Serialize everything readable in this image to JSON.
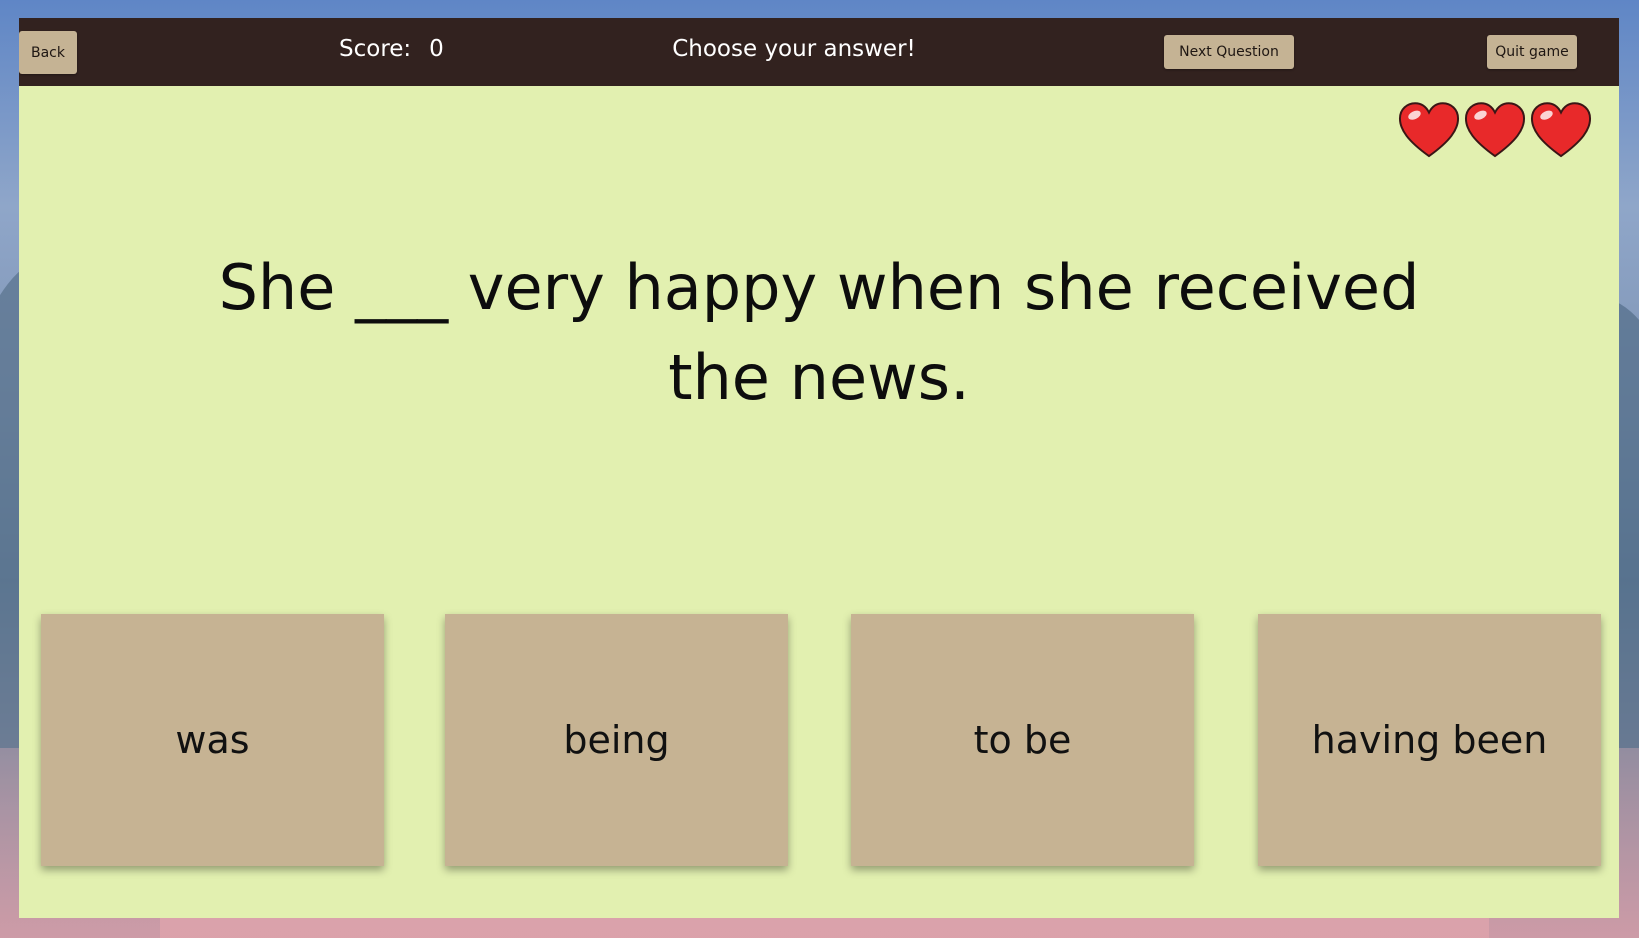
{
  "toolbar": {
    "back_label": "Back",
    "score_label": "Score:",
    "score_value": "0",
    "instruction": "Choose your answer!",
    "next_label": "Next Question",
    "quit_label": "Quit game"
  },
  "lives": {
    "count": 3,
    "icon": "heart-icon",
    "color": "#e8292a"
  },
  "question": {
    "text": "She ___ very happy when she received the news."
  },
  "answers": [
    {
      "label": "was"
    },
    {
      "label": "being"
    },
    {
      "label": "to be"
    },
    {
      "label": "having been"
    }
  ],
  "colors": {
    "topbar": "#32221f",
    "board": "#e2f0b0",
    "card": "#c6b393"
  }
}
